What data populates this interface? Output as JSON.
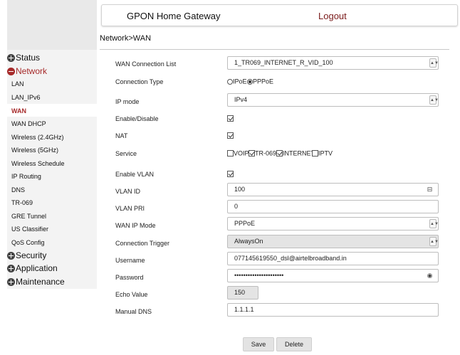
{
  "header": {
    "title": "GPON Home Gateway",
    "logout_label": "Logout"
  },
  "breadcrumb": "Network>WAN",
  "sidebar": {
    "categories": [
      {
        "label": "Status"
      },
      {
        "label": "Network"
      },
      {
        "label": "Security"
      },
      {
        "label": "Application"
      },
      {
        "label": "Maintenance"
      }
    ],
    "network_items": [
      {
        "label": "LAN"
      },
      {
        "label": "LAN_IPv6"
      },
      {
        "label": "WAN"
      },
      {
        "label": "WAN DHCP"
      },
      {
        "label": "Wireless (2.4GHz)"
      },
      {
        "label": "Wireless (5GHz)"
      },
      {
        "label": "Wireless Schedule"
      },
      {
        "label": "IP Routing"
      },
      {
        "label": "DNS"
      },
      {
        "label": "TR-069"
      },
      {
        "label": "GRE Tunnel"
      },
      {
        "label": "US Classifier"
      },
      {
        "label": "QoS Config"
      }
    ]
  },
  "form": {
    "wan_connection_list": {
      "label": "WAN Connection List",
      "value": "1_TR069_INTERNET_R_VID_100"
    },
    "connection_type": {
      "label": "Connection Type",
      "options": [
        "IPoE",
        "PPPoE"
      ],
      "selected": "PPPoE"
    },
    "ip_mode": {
      "label": "IP mode",
      "value": "IPv4"
    },
    "enable_disable": {
      "label": "Enable/Disable",
      "checked": true
    },
    "nat": {
      "label": "NAT",
      "checked": true
    },
    "service": {
      "label": "Service",
      "options": [
        {
          "label": "VOIP",
          "checked": false
        },
        {
          "label": "TR-069",
          "checked": true
        },
        {
          "label": "INTERNET",
          "checked": true
        },
        {
          "label": "IPTV",
          "checked": false
        }
      ]
    },
    "enable_vlan": {
      "label": "Enable VLAN",
      "checked": true
    },
    "vlan_id": {
      "label": "VLAN ID",
      "value": "100"
    },
    "vlan_pri": {
      "label": "VLAN PRI",
      "value": "0"
    },
    "wan_ip_mode": {
      "label": "WAN IP Mode",
      "value": "PPPoE"
    },
    "connection_trigger": {
      "label": "Connection Trigger",
      "value": "AlwaysOn"
    },
    "username": {
      "label": "Username",
      "value": "077145619550_dsl@airtelbroadband.in"
    },
    "password": {
      "label": "Password",
      "value": "••••••••••••••••••••••"
    },
    "echo_value": {
      "label": "Echo Value",
      "value": "150"
    },
    "manual_dns": {
      "label": "Manual DNS",
      "value": "1.1.1.1"
    }
  },
  "buttons": {
    "save_label": "Save",
    "delete_label": "Delete"
  },
  "colors": {
    "accent": "#a62a2a",
    "sidebar_bg": "#f3f3f3",
    "disabled_bg": "#e4e4e4"
  }
}
